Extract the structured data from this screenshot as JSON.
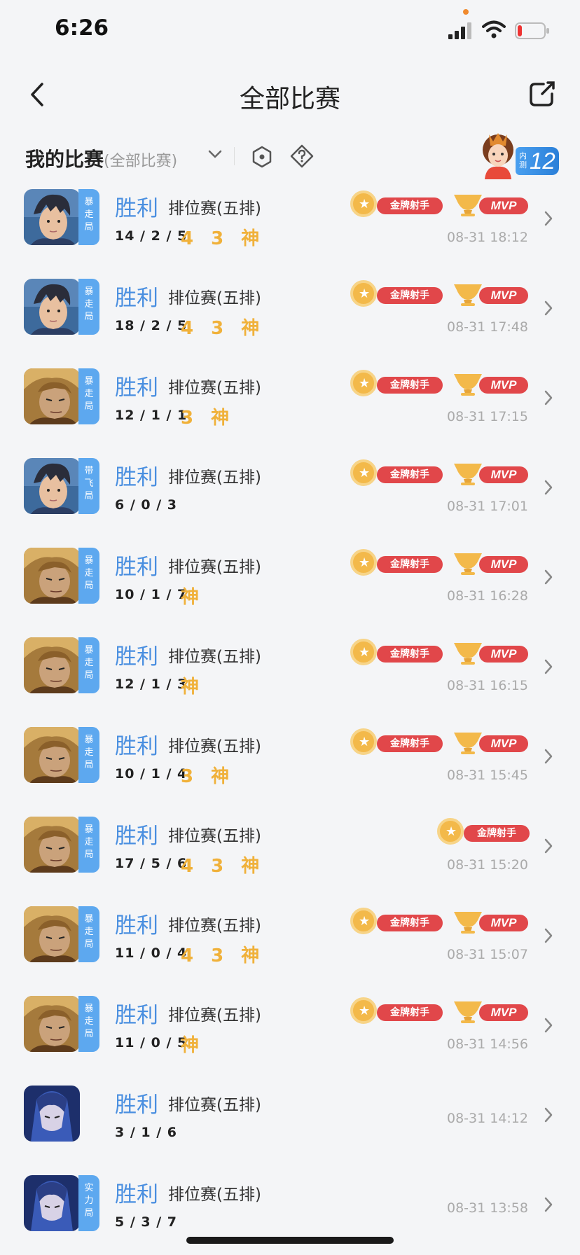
{
  "status_bar": {
    "time": "6:26"
  },
  "nav": {
    "title": "全部比赛"
  },
  "filter": {
    "label": "我的比赛",
    "sub_label": "(全部比赛)",
    "rank_number": "12",
    "rank_prefix": "内测"
  },
  "matches": [
    {
      "result": "胜利",
      "mode": "排位赛(五排)",
      "kda": "14 / 2 / 5",
      "marks": "4 3 神",
      "time": "08-31 18:12",
      "position": "暴走局",
      "hero": "hero-a",
      "gold_medal": "金牌射手",
      "mvp": "MVP"
    },
    {
      "result": "胜利",
      "mode": "排位赛(五排)",
      "kda": "18 / 2 / 5",
      "marks": "4 3 神",
      "time": "08-31 17:48",
      "position": "暴走局",
      "hero": "hero-a",
      "gold_medal": "金牌射手",
      "mvp": "MVP"
    },
    {
      "result": "胜利",
      "mode": "排位赛(五排)",
      "kda": "12 / 1 / 1",
      "marks": "3 神",
      "time": "08-31 17:15",
      "position": "暴走局",
      "hero": "hero-b",
      "gold_medal": "金牌射手",
      "mvp": "MVP"
    },
    {
      "result": "胜利",
      "mode": "排位赛(五排)",
      "kda": "6 / 0 / 3",
      "marks": "",
      "time": "08-31 17:01",
      "position": "带飞局",
      "hero": "hero-a",
      "gold_medal": "金牌射手",
      "mvp": "MVP"
    },
    {
      "result": "胜利",
      "mode": "排位赛(五排)",
      "kda": "10 / 1 / 7",
      "marks": "神",
      "time": "08-31 16:28",
      "position": "暴走局",
      "hero": "hero-b",
      "gold_medal": "金牌射手",
      "mvp": "MVP"
    },
    {
      "result": "胜利",
      "mode": "排位赛(五排)",
      "kda": "12 / 1 / 3",
      "marks": "神",
      "time": "08-31 16:15",
      "position": "暴走局",
      "hero": "hero-b",
      "gold_medal": "金牌射手",
      "mvp": "MVP"
    },
    {
      "result": "胜利",
      "mode": "排位赛(五排)",
      "kda": "10 / 1 / 4",
      "marks": "3 神",
      "time": "08-31 15:45",
      "position": "暴走局",
      "hero": "hero-b",
      "gold_medal": "金牌射手",
      "mvp": "MVP"
    },
    {
      "result": "胜利",
      "mode": "排位赛(五排)",
      "kda": "17 / 5 / 6",
      "marks": "4 3 神",
      "time": "08-31 15:20",
      "position": "暴走局",
      "hero": "hero-b",
      "gold_medal": "金牌射手",
      "mvp": ""
    },
    {
      "result": "胜利",
      "mode": "排位赛(五排)",
      "kda": "11 / 0 / 4",
      "marks": "4 3 神",
      "time": "08-31 15:07",
      "position": "暴走局",
      "hero": "hero-b",
      "gold_medal": "金牌射手",
      "mvp": "MVP"
    },
    {
      "result": "胜利",
      "mode": "排位赛(五排)",
      "kda": "11 / 0 / 5",
      "marks": "神",
      "time": "08-31 14:56",
      "position": "暴走局",
      "hero": "hero-b",
      "gold_medal": "金牌射手",
      "mvp": "MVP"
    },
    {
      "result": "胜利",
      "mode": "排位赛(五排)",
      "kda": "3 / 1 / 6",
      "marks": "",
      "time": "08-31 14:12",
      "position": "",
      "hero": "hero-c",
      "gold_medal": "",
      "mvp": ""
    },
    {
      "result": "胜利",
      "mode": "排位赛(五排)",
      "kda": "5 / 3 / 7",
      "marks": "",
      "time": "08-31 13:58",
      "position": "实力局",
      "hero": "hero-c",
      "gold_medal": "",
      "mvp": ""
    }
  ],
  "colors": {
    "win": "#4a8fe0",
    "accent_gold": "#f0b13a",
    "medal_red": "#e1474a",
    "position_tab": "#5da8ef"
  },
  "icons": [
    "back-icon",
    "share-icon",
    "chevron-down-icon",
    "hexagon-icon",
    "help-icon",
    "chevron-right-icon"
  ]
}
